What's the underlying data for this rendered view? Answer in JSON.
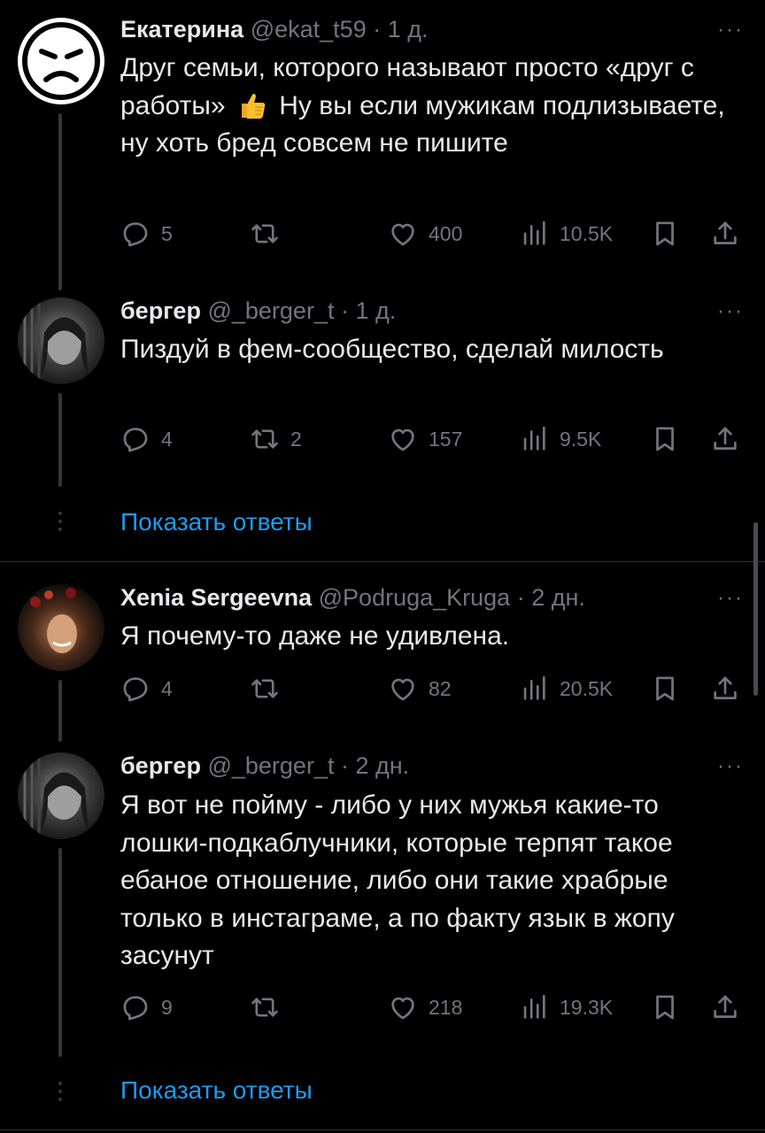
{
  "tweets": [
    {
      "name": "Екатерина",
      "handle": "@ekat_t59",
      "sep": "·",
      "time": "1 д.",
      "more": "···",
      "text_before": "Друг семьи, которого называют просто «друг с работы»",
      "emoji": "thumbs-up",
      "text_after": "Ну вы если мужикам подлизываете, ну хоть бред совсем не пишите",
      "replies": "5",
      "retweets": "",
      "likes": "400",
      "views": "10.5K"
    },
    {
      "name": "бергер",
      "handle": "@_berger_t",
      "sep": "·",
      "time": "1 д.",
      "more": "···",
      "text": "Пиздуй в фем-сообщество, сделай милость",
      "replies": "4",
      "retweets": "2",
      "likes": "157",
      "views": "9.5K"
    },
    {
      "name": "Xenia Sergeevna",
      "handle": "@Podruga_Kruga",
      "sep": "·",
      "time": "2 дн.",
      "more": "···",
      "text": "Я почему-то даже не удивлена.",
      "replies": "4",
      "retweets": "",
      "likes": "82",
      "views": "20.5K"
    },
    {
      "name": "бергер",
      "handle": "@_berger_t",
      "sep": "·",
      "time": "2 дн.",
      "more": "···",
      "text": "Я вот не пойму - либо у них мужья какие-то лошки-подкаблучники, которые терпят такое ебаное отношение, либо они такие храбрые только в инстаграме, а по факту язык в жопу засунут",
      "replies": "9",
      "retweets": "",
      "likes": "218",
      "views": "19.3K"
    }
  ],
  "show_replies_label": "Показать ответы",
  "colors": {
    "background": "#000000",
    "text": "#e7e9ea",
    "muted": "#71767b",
    "link": "#1d9bf0"
  }
}
